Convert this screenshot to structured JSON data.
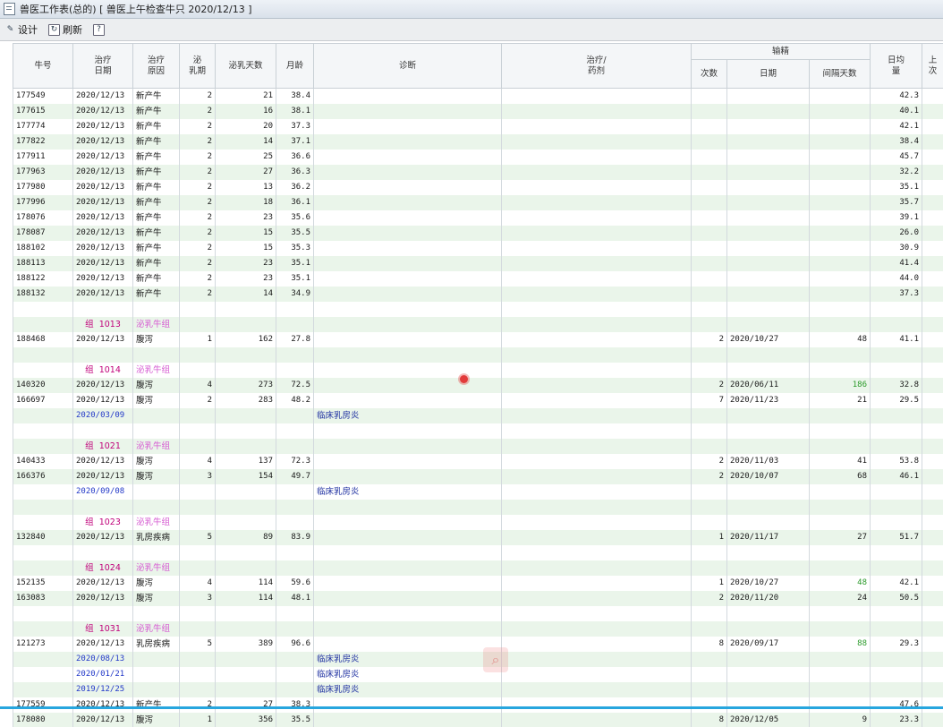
{
  "window": {
    "title": "兽医工作表(总的)  [ 兽医上午检查牛只 2020/12/13 ]"
  },
  "toolbar": {
    "design_label": "设计",
    "refresh_label": "刷新",
    "help_label": "?"
  },
  "columns": {
    "cow_id": "牛号",
    "treat_date": "治疗\n日期",
    "treat_reason": "治疗\n原因",
    "lactation": "泌\n乳期",
    "milk_days": "泌乳天数",
    "age_months": "月龄",
    "diagnosis": "诊断",
    "treatment": "治疗/\n药剂",
    "breeding_group": "输精",
    "times": "次数",
    "date": "日期",
    "interval_days": "间隔天数",
    "daily_avg": "日均\n量",
    "last_partial": "上\n次"
  },
  "rows": [
    {
      "type": "data",
      "id": "177549",
      "date": "2020/12/13",
      "reason": "新产牛",
      "lact": "2",
      "days": "21",
      "age": "38.4",
      "avg": "42.3"
    },
    {
      "type": "data",
      "id": "177615",
      "date": "2020/12/13",
      "reason": "新产牛",
      "lact": "2",
      "days": "16",
      "age": "38.1",
      "avg": "40.1"
    },
    {
      "type": "data",
      "id": "177774",
      "date": "2020/12/13",
      "reason": "新产牛",
      "lact": "2",
      "days": "20",
      "age": "37.3",
      "avg": "42.1"
    },
    {
      "type": "data",
      "id": "177822",
      "date": "2020/12/13",
      "reason": "新产牛",
      "lact": "2",
      "days": "14",
      "age": "37.1",
      "avg": "38.4"
    },
    {
      "type": "data",
      "id": "177911",
      "date": "2020/12/13",
      "reason": "新产牛",
      "lact": "2",
      "days": "25",
      "age": "36.6",
      "avg": "45.7"
    },
    {
      "type": "data",
      "id": "177963",
      "date": "2020/12/13",
      "reason": "新产牛",
      "lact": "2",
      "days": "27",
      "age": "36.3",
      "avg": "32.2"
    },
    {
      "type": "data",
      "id": "177980",
      "date": "2020/12/13",
      "reason": "新产牛",
      "lact": "2",
      "days": "13",
      "age": "36.2",
      "avg": "35.1"
    },
    {
      "type": "data",
      "id": "177996",
      "date": "2020/12/13",
      "reason": "新产牛",
      "lact": "2",
      "days": "18",
      "age": "36.1",
      "avg": "35.7"
    },
    {
      "type": "data",
      "id": "178076",
      "date": "2020/12/13",
      "reason": "新产牛",
      "lact": "2",
      "days": "23",
      "age": "35.6",
      "avg": "39.1"
    },
    {
      "type": "data",
      "id": "178087",
      "date": "2020/12/13",
      "reason": "新产牛",
      "lact": "2",
      "days": "15",
      "age": "35.5",
      "avg": "26.0"
    },
    {
      "type": "data",
      "id": "188102",
      "date": "2020/12/13",
      "reason": "新产牛",
      "lact": "2",
      "days": "15",
      "age": "35.3",
      "avg": "30.9"
    },
    {
      "type": "data",
      "id": "188113",
      "date": "2020/12/13",
      "reason": "新产牛",
      "lact": "2",
      "days": "23",
      "age": "35.1",
      "avg": "41.4"
    },
    {
      "type": "data",
      "id": "188122",
      "date": "2020/12/13",
      "reason": "新产牛",
      "lact": "2",
      "days": "23",
      "age": "35.1",
      "avg": "44.0"
    },
    {
      "type": "data",
      "id": "188132",
      "date": "2020/12/13",
      "reason": "新产牛",
      "lact": "2",
      "days": "14",
      "age": "34.9",
      "avg": "37.3"
    },
    {
      "type": "blank"
    },
    {
      "type": "group",
      "label": "组",
      "num": "1013",
      "name": "泌乳牛组"
    },
    {
      "type": "data",
      "id": "188468",
      "date": "2020/12/13",
      "reason": "腹泻",
      "lact": "1",
      "days": "162",
      "age": "27.8",
      "times": "2",
      "bdate": "2020/10/27",
      "interval": "48",
      "avg": "41.1"
    },
    {
      "type": "blank"
    },
    {
      "type": "group",
      "label": "组",
      "num": "1014",
      "name": "泌乳牛组"
    },
    {
      "type": "data",
      "id": "140320",
      "date": "2020/12/13",
      "reason": "腹泻",
      "lact": "4",
      "days": "273",
      "age": "72.5",
      "times": "2",
      "bdate": "2020/06/11",
      "interval": "186",
      "interval_green": true,
      "avg": "32.8"
    },
    {
      "type": "data",
      "id": "166697",
      "date": "2020/12/13",
      "reason": "腹泻",
      "lact": "2",
      "days": "283",
      "age": "48.2",
      "times": "7",
      "bdate": "2020/11/23",
      "interval": "21",
      "avg": "29.5"
    },
    {
      "type": "sub",
      "date": "2020/03/09",
      "diag": "临床乳房炎"
    },
    {
      "type": "blank"
    },
    {
      "type": "group",
      "label": "组",
      "num": "1021",
      "name": "泌乳牛组"
    },
    {
      "type": "data",
      "id": "140433",
      "date": "2020/12/13",
      "reason": "腹泻",
      "lact": "4",
      "days": "137",
      "age": "72.3",
      "times": "2",
      "bdate": "2020/11/03",
      "interval": "41",
      "avg": "53.8"
    },
    {
      "type": "data",
      "id": "166376",
      "date": "2020/12/13",
      "reason": "腹泻",
      "lact": "3",
      "days": "154",
      "age": "49.7",
      "times": "2",
      "bdate": "2020/10/07",
      "interval": "68",
      "avg": "46.1"
    },
    {
      "type": "sub",
      "date": "2020/09/08",
      "diag": "临床乳房炎"
    },
    {
      "type": "blank"
    },
    {
      "type": "group",
      "label": "组",
      "num": "1023",
      "name": "泌乳牛组"
    },
    {
      "type": "data",
      "id": "132840",
      "date": "2020/12/13",
      "reason": "乳房疾病",
      "lact": "5",
      "days": "89",
      "age": "83.9",
      "times": "1",
      "bdate": "2020/11/17",
      "interval": "27",
      "avg": "51.7"
    },
    {
      "type": "blank"
    },
    {
      "type": "group",
      "label": "组",
      "num": "1024",
      "name": "泌乳牛组"
    },
    {
      "type": "data",
      "id": "152135",
      "date": "2020/12/13",
      "reason": "腹泻",
      "lact": "4",
      "days": "114",
      "age": "59.6",
      "times": "1",
      "bdate": "2020/10/27",
      "interval": "48",
      "interval_green": true,
      "avg": "42.1"
    },
    {
      "type": "data",
      "id": "163083",
      "date": "2020/12/13",
      "reason": "腹泻",
      "lact": "3",
      "days": "114",
      "age": "48.1",
      "times": "2",
      "bdate": "2020/11/20",
      "interval": "24",
      "avg": "50.5"
    },
    {
      "type": "blank"
    },
    {
      "type": "group",
      "label": "组",
      "num": "1031",
      "name": "泌乳牛组"
    },
    {
      "type": "data",
      "id": "121273",
      "date": "2020/12/13",
      "reason": "乳房疾病",
      "lact": "5",
      "days": "389",
      "age": "96.6",
      "times": "8",
      "bdate": "2020/09/17",
      "interval": "88",
      "interval_green": true,
      "avg": "29.3"
    },
    {
      "type": "sub",
      "date": "2020/08/13",
      "diag": "临床乳房炎"
    },
    {
      "type": "sub",
      "date": "2020/01/21",
      "diag": "临床乳房炎"
    },
    {
      "type": "sub",
      "date": "2019/12/25",
      "diag": "临床乳房炎"
    },
    {
      "type": "data",
      "id": "177559",
      "date": "2020/12/13",
      "reason": "新产牛",
      "lact": "2",
      "days": "27",
      "age": "38.3",
      "avg": "47.6"
    },
    {
      "type": "data",
      "id": "178080",
      "date": "2020/12/13",
      "reason": "腹泻",
      "lact": "1",
      "days": "356",
      "age": "35.5",
      "times": "8",
      "bdate": "2020/12/05",
      "interval": "9",
      "avg": "23.3"
    }
  ],
  "colors": {
    "row_stripe": "#eaf5ea",
    "group_label": "#c0007a",
    "group_name": "#d65bd2",
    "diagnosis_text": "#1d2fa0",
    "interval_highlight": "#2a9a2a",
    "accent_line": "#27a6de"
  }
}
